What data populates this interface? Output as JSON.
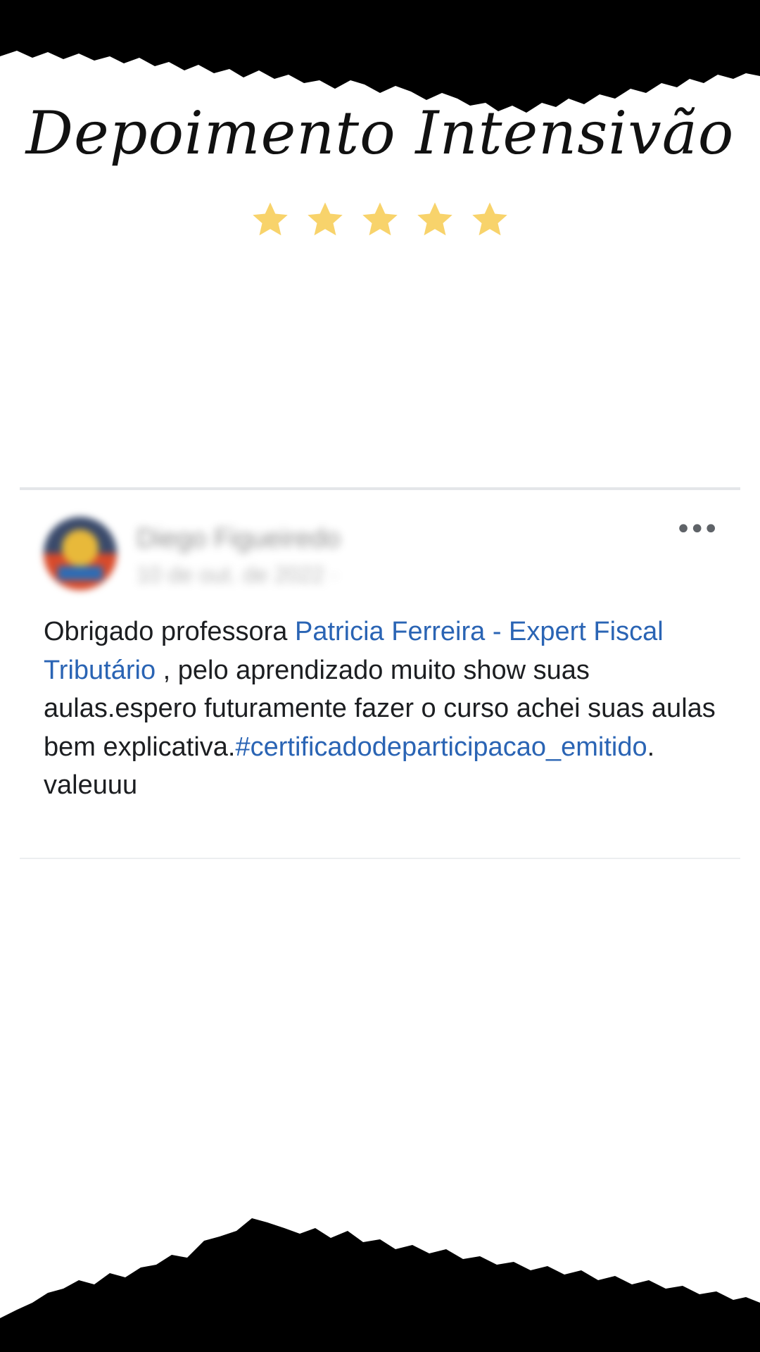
{
  "header": {
    "title": "Depoimento Intensivão",
    "rating": 5,
    "star_color": "#f8d36b"
  },
  "post": {
    "author": "Diego Figueiredo",
    "meta": "10 de out. de 2022 · ",
    "more_label": "•••",
    "text_1": "Obrigado professora ",
    "mention": "Patricia Ferreira - Expert Fiscal Tributário",
    "text_2": " , pelo aprendizado muito show suas aulas.espero futuramente fazer o curso achei suas aulas bem explicativa.",
    "hashtag": "#certificadodeparticipacao_emitido",
    "text_3": ". valeuuu",
    "link_color": "#2a64b4"
  }
}
